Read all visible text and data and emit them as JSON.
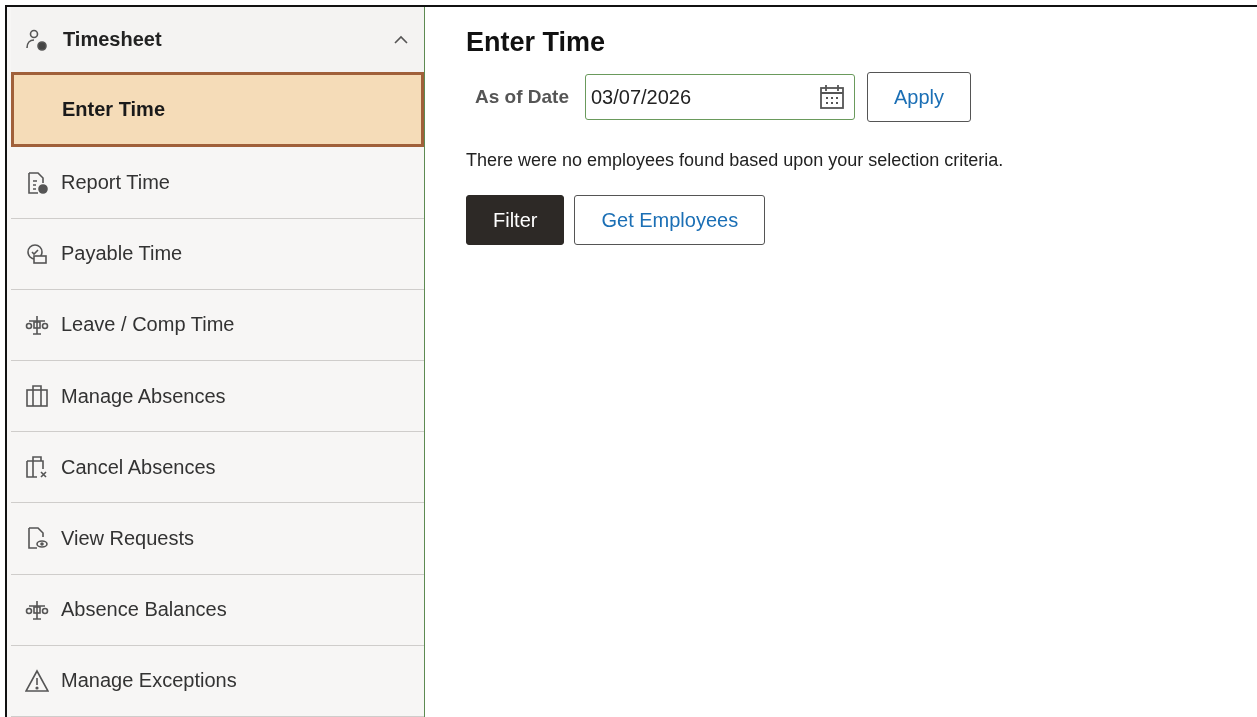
{
  "sidebar": {
    "header": {
      "title": "Timesheet",
      "expanded": true
    },
    "items": [
      {
        "label": "Enter Time",
        "selected": true
      },
      {
        "label": "Report Time",
        "selected": false
      },
      {
        "label": "Payable Time",
        "selected": false
      },
      {
        "label": "Leave / Comp Time",
        "selected": false
      },
      {
        "label": "Manage Absences",
        "selected": false
      },
      {
        "label": "Cancel Absences",
        "selected": false
      },
      {
        "label": "View Requests",
        "selected": false
      },
      {
        "label": "Absence Balances",
        "selected": false
      },
      {
        "label": "Manage Exceptions",
        "selected": false
      }
    ]
  },
  "main": {
    "title": "Enter Time",
    "date_label": "As of Date",
    "date_value": "03/07/2026",
    "apply_button": "Apply",
    "message": "There were no employees found based upon your selection criteria.",
    "buttons": [
      {
        "label": "Filter",
        "kind": "primary"
      },
      {
        "label": "Get Employees",
        "kind": "secondary"
      }
    ]
  }
}
